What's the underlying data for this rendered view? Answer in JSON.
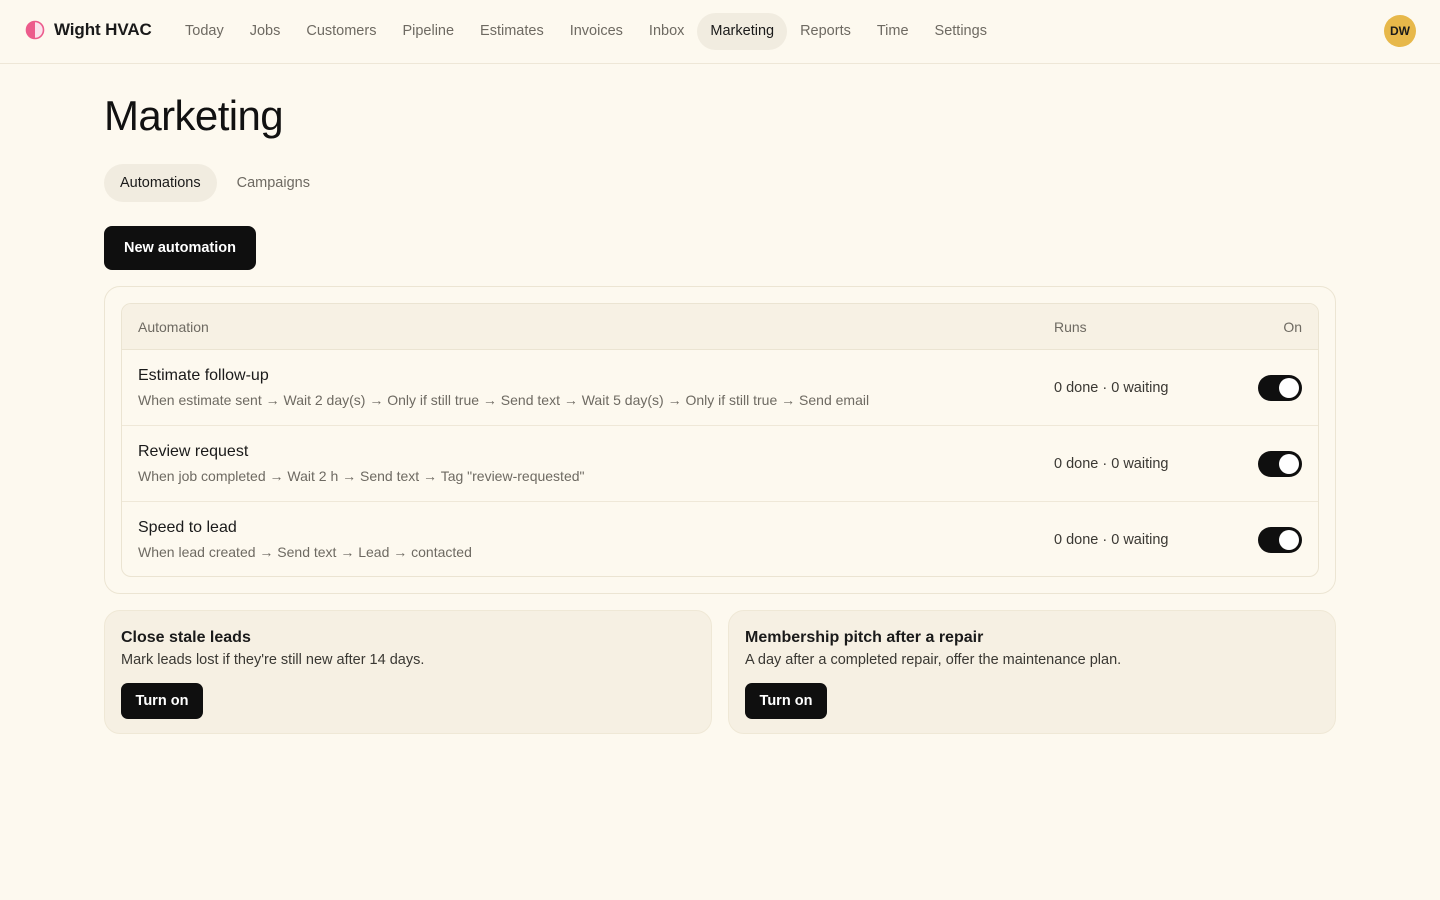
{
  "app": {
    "name": "Wight HVAC",
    "logo_icon": "half-circle-logo-icon",
    "accent": "#ec5c8c"
  },
  "nav": {
    "items": [
      {
        "label": "Today",
        "active": false
      },
      {
        "label": "Jobs",
        "active": false
      },
      {
        "label": "Customers",
        "active": false
      },
      {
        "label": "Pipeline",
        "active": false
      },
      {
        "label": "Estimates",
        "active": false
      },
      {
        "label": "Invoices",
        "active": false
      },
      {
        "label": "Inbox",
        "active": false
      },
      {
        "label": "Marketing",
        "active": true
      },
      {
        "label": "Reports",
        "active": false
      },
      {
        "label": "Time",
        "active": false
      },
      {
        "label": "Settings",
        "active": false
      }
    ]
  },
  "user": {
    "initials": "DW",
    "avatar_color": "#e7b84a"
  },
  "page": {
    "title": "Marketing"
  },
  "tabs": [
    {
      "label": "Automations",
      "active": true
    },
    {
      "label": "Campaigns",
      "active": false
    }
  ],
  "actions": {
    "new_automation": "New automation"
  },
  "table": {
    "headers": {
      "automation": "Automation",
      "runs": "Runs",
      "on": "On"
    },
    "rows": [
      {
        "title": "Estimate follow-up",
        "description": "When estimate sent → Wait 2 day(s) → Only if still true → Send text → Wait 5 day(s) → Only if still true → Send email",
        "runs": "0 done · 0 waiting",
        "enabled": true
      },
      {
        "title": "Review request",
        "description": "When job completed → Wait 2 h → Send text → Tag \"review-requested\"",
        "runs": "0 done · 0 waiting",
        "enabled": true
      },
      {
        "title": "Speed to lead",
        "description": "When lead created → Send text → Lead → contacted",
        "runs": "0 done · 0 waiting",
        "enabled": true
      }
    ]
  },
  "suggestions": [
    {
      "title": "Close stale leads",
      "description": "Mark leads lost if they're still new after 14 days.",
      "button": "Turn on"
    },
    {
      "title": "Membership pitch after a repair",
      "description": "A day after a completed repair, offer the maintenance plan.",
      "button": "Turn on"
    }
  ]
}
